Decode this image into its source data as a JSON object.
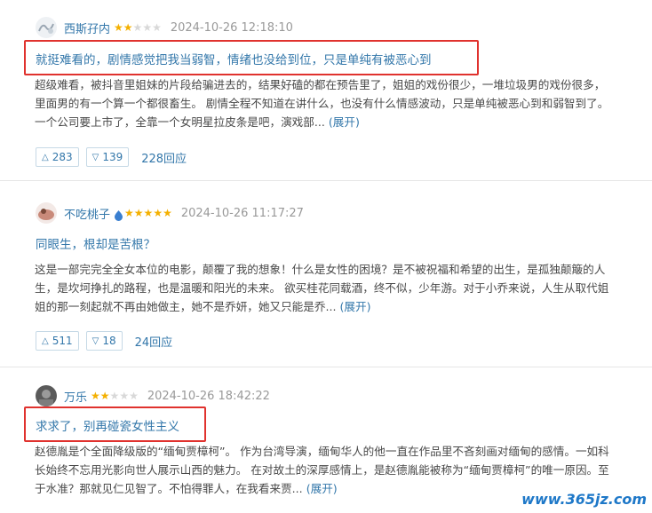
{
  "reviews": [
    {
      "username": "西斯孖内",
      "rating": 2,
      "time": "2024-10-26 12:18:10",
      "title": "就挺难看的，剧情感觉把我当弱智，情绪也没给到位，只是单纯有被恶心到",
      "lines": [
        "超级难看，被抖音里姐妹的片段给骗进去的，结果好磕的都在预告里了，姐姐的戏份很少，一堆垃圾男的戏份很多，",
        "里面男的有一个算一个都很畜生。 剧情全程不知道在讲什么，也没有什么情感波动，只是单纯被恶心到和弱智到了。",
        "一个公司要上市了，全靠一个女明星拉皮条是吧，演戏部..."
      ],
      "expand": "(展开)",
      "up": "283",
      "down": "139",
      "replies": "228回应"
    },
    {
      "username": "不吃桃子",
      "rating": 5,
      "time": "2024-10-26 11:17:27",
      "title": "同眼生，根却是苦根？",
      "lines": [
        "这是一部完完全全女本位的电影，颠覆了我的想象！什么是女性的困境？是不被祝福和希望的出生，是孤独颠簸的人",
        "生，是坎坷挣扎的路程，也是温暖和阳光的未来。 欲买桂花同载酒，终不似，少年游。对于小乔来说，人生从取代姐",
        "姐的那一刻起就不再由她做主，她不是乔妍，她又只能是乔..."
      ],
      "expand": "(展开)",
      "up": "511",
      "down": "18",
      "replies": "24回应"
    },
    {
      "username": "万乐",
      "rating": 2,
      "time": "2024-10-26 18:42:22",
      "title": "求求了，别再碰瓷女性主义",
      "lines": [
        "赵德胤是个全面降级版的“缅甸贾樟柯”。 作为台湾导演，缅甸华人的他一直在作品里不吝刻画对缅甸的感情。一如科",
        "长始终不忘用光影向世人展示山西的魅力。 在对故土的深厚感情上，是赵德胤能被称为“缅甸贾樟柯”的唯一原因。至",
        "于水准？那就见仁见智了。不怕得罪人，在我看来贾..."
      ],
      "expand": "(展开)"
    }
  ],
  "watermark": "www.365jz.com",
  "colors": {
    "link": "#3377aa",
    "star": "#f4b000",
    "highlight_border": "#e0322e",
    "watermark": "#1e78c8"
  },
  "icons": {
    "up": "triangle-up-icon",
    "down": "triangle-down-icon",
    "vip": "vip-badge-icon"
  }
}
